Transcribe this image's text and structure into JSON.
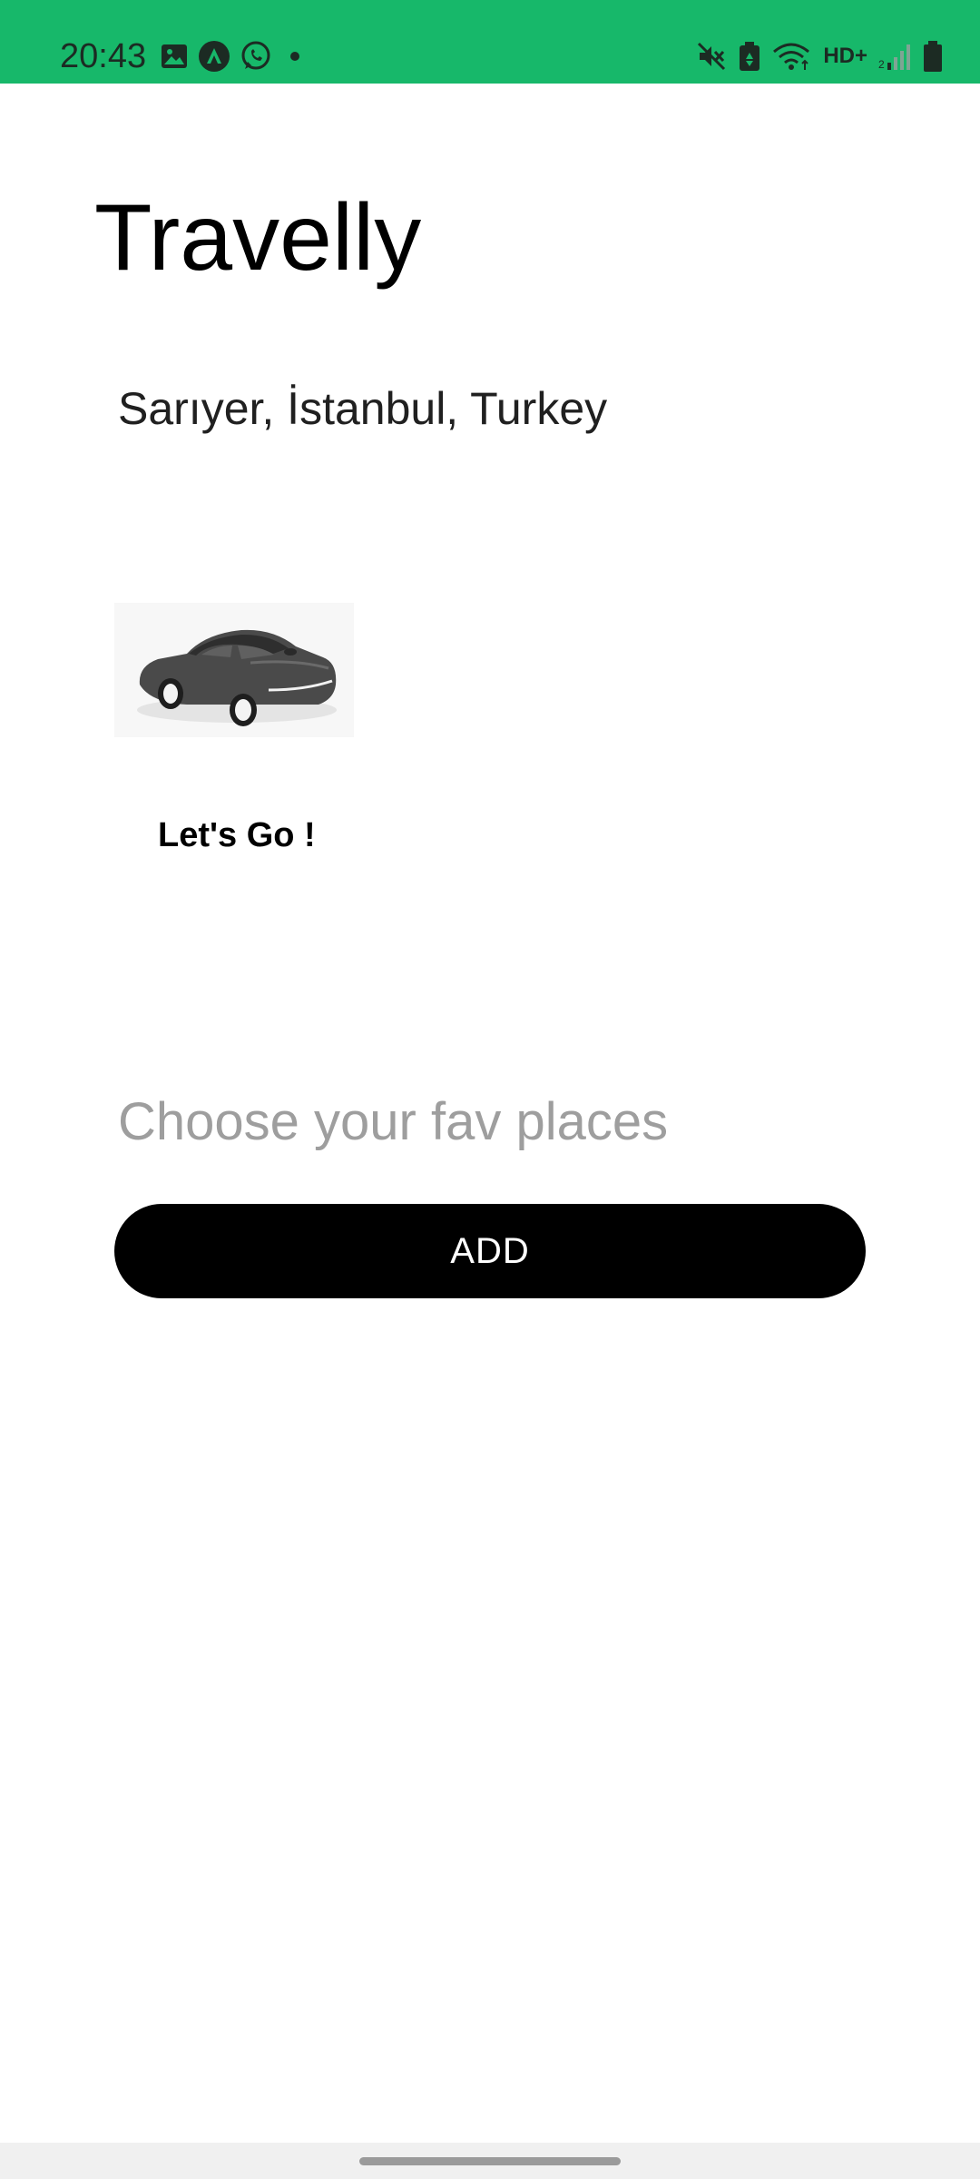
{
  "status_bar": {
    "time": "20:43",
    "network_label": "HD+",
    "left_icons": [
      "gallery-icon",
      "app-a-icon",
      "whatsapp-icon",
      "dot-icon"
    ],
    "right_icons": [
      "mute-icon",
      "battery-saver-icon",
      "wifi-icon",
      "signal-icon",
      "battery-icon"
    ],
    "background_color": "#17b86a"
  },
  "app": {
    "title": "Travelly",
    "location": "Sarıyer, İstanbul, Turkey",
    "car_image_icon": "car-icon",
    "go_label": "Let's Go !",
    "fav_input": {
      "value": "",
      "placeholder": "Choose your fav places"
    },
    "add_button_label": "ADD"
  },
  "colors": {
    "accent": "#17b86a",
    "button": "#000000",
    "button_text": "#ffffff",
    "placeholder": "#9e9e9e"
  }
}
